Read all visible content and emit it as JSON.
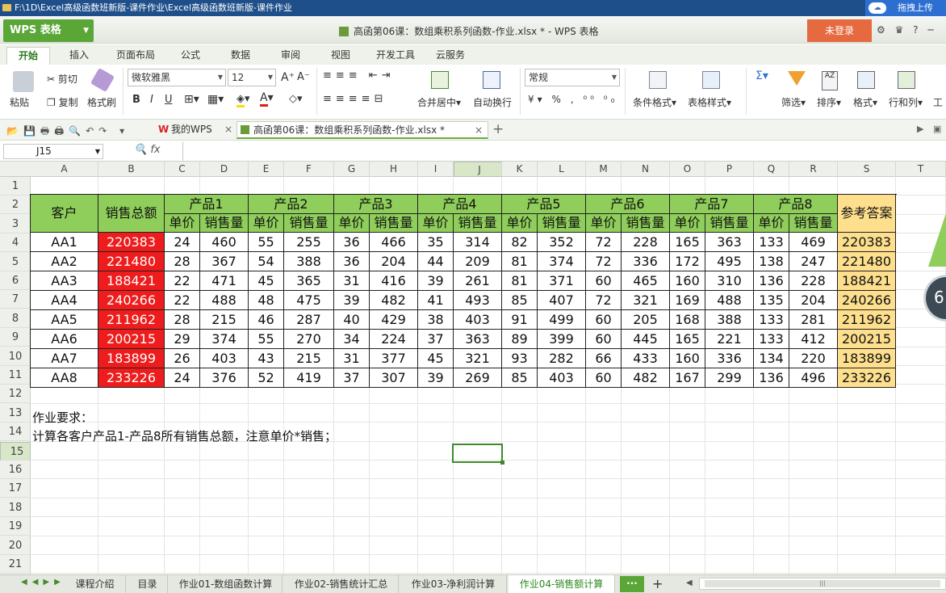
{
  "window": {
    "path": "F:\\1D\\Excel高级函数班新版-课件作业\\Excel高级函数班新版-课件作业",
    "upload_label": "拖拽上传",
    "app_button": "WPS 表格",
    "doc_title": "高函第06课：数组乘积系列函数-作业.xlsx * - WPS 表格",
    "login_label": "未登录",
    "window_icons": "⚙ ♛ ? ─"
  },
  "ribbon_tabs": [
    "开始",
    "插入",
    "页面布局",
    "公式",
    "数据",
    "审阅",
    "视图",
    "开发工具",
    "云服务"
  ],
  "ribbon": {
    "paste": "粘贴",
    "cut": "剪切",
    "copy": "复制",
    "format_painter": "格式刷",
    "font_name": "微软雅黑",
    "font_size": "12",
    "merge_center": "合并居中",
    "wrap_text": "自动换行",
    "number_format": "常规",
    "cond_format": "条件格式",
    "table_style": "表格样式",
    "filter": "筛选",
    "sort": "排序",
    "format": "格式",
    "row_col": "行和列",
    "worksheet": "工"
  },
  "doc_tabs": [
    {
      "label": "我的WPS"
    },
    {
      "label": "高函第06课：数组乘积系列函数-作业.xlsx *"
    }
  ],
  "formula_bar": {
    "name_box": "J15",
    "fx": "fx",
    "value": ""
  },
  "columns": [
    "A",
    "B",
    "C",
    "D",
    "E",
    "F",
    "G",
    "H",
    "I",
    "J",
    "K",
    "L",
    "M",
    "N",
    "O",
    "P",
    "Q",
    "R",
    "S",
    "T"
  ],
  "rows": [
    "1",
    "2",
    "3",
    "4",
    "5",
    "6",
    "7",
    "8",
    "9",
    "10",
    "11",
    "12",
    "13",
    "14",
    "15",
    "16",
    "17",
    "18",
    "19",
    "20",
    "21"
  ],
  "selected_cell": "J15",
  "table": {
    "customer_header": "客户",
    "total_header": "销售总额",
    "answer_header": "参考答案",
    "products": [
      "产品1",
      "产品2",
      "产品3",
      "产品4",
      "产品5",
      "产品6",
      "产品7",
      "产品8"
    ],
    "price_label": "单价",
    "qty_label": "销售量",
    "records": [
      {
        "customer": "AA1",
        "total": "220383",
        "vals": [
          "24",
          "460",
          "55",
          "255",
          "36",
          "466",
          "35",
          "314",
          "82",
          "352",
          "72",
          "228",
          "165",
          "363",
          "133",
          "469"
        ],
        "answer": "220383"
      },
      {
        "customer": "AA2",
        "total": "221480",
        "vals": [
          "28",
          "367",
          "54",
          "388",
          "36",
          "204",
          "44",
          "209",
          "81",
          "374",
          "72",
          "336",
          "172",
          "495",
          "138",
          "247"
        ],
        "answer": "221480"
      },
      {
        "customer": "AA3",
        "total": "188421",
        "vals": [
          "22",
          "471",
          "45",
          "365",
          "31",
          "416",
          "39",
          "261",
          "81",
          "371",
          "60",
          "465",
          "160",
          "310",
          "136",
          "228"
        ],
        "answer": "188421"
      },
      {
        "customer": "AA4",
        "total": "240266",
        "vals": [
          "22",
          "488",
          "48",
          "475",
          "39",
          "482",
          "41",
          "493",
          "85",
          "407",
          "72",
          "321",
          "169",
          "488",
          "135",
          "204"
        ],
        "answer": "240266"
      },
      {
        "customer": "AA5",
        "total": "211962",
        "vals": [
          "28",
          "215",
          "46",
          "287",
          "40",
          "429",
          "38",
          "403",
          "91",
          "499",
          "60",
          "205",
          "168",
          "388",
          "133",
          "281"
        ],
        "answer": "211962"
      },
      {
        "customer": "AA6",
        "total": "200215",
        "vals": [
          "29",
          "374",
          "55",
          "270",
          "34",
          "224",
          "37",
          "363",
          "89",
          "399",
          "60",
          "445",
          "165",
          "221",
          "133",
          "412"
        ],
        "answer": "200215"
      },
      {
        "customer": "AA7",
        "total": "183899",
        "vals": [
          "26",
          "403",
          "43",
          "215",
          "31",
          "377",
          "45",
          "321",
          "93",
          "282",
          "66",
          "433",
          "160",
          "336",
          "134",
          "220"
        ],
        "answer": "183899"
      },
      {
        "customer": "AA8",
        "total": "233226",
        "vals": [
          "24",
          "376",
          "52",
          "419",
          "37",
          "307",
          "39",
          "269",
          "85",
          "403",
          "60",
          "482",
          "167",
          "299",
          "136",
          "496"
        ],
        "answer": "233226"
      }
    ]
  },
  "notes": {
    "line1": "作业要求：",
    "line2": "计算各客户产品1-产品8所有销售总额，注意单价*销售；"
  },
  "side_badge": "6",
  "sheet_tabs": [
    "课程介绍",
    "目录",
    "作业01-数组函数计算",
    "作业02-销售统计汇总",
    "作业03-净利润计算",
    "作业04-销售额计算"
  ],
  "active_sheet": "作业04-销售额计算",
  "more_tabs": "···",
  "add_sheet": "+",
  "colors": {
    "header_green": "#8fce5a",
    "total_red": "#ee1c1c",
    "answer_yellow": "#fddf8d",
    "brand_green": "#5aa637",
    "login_orange": "#e56a3f"
  }
}
